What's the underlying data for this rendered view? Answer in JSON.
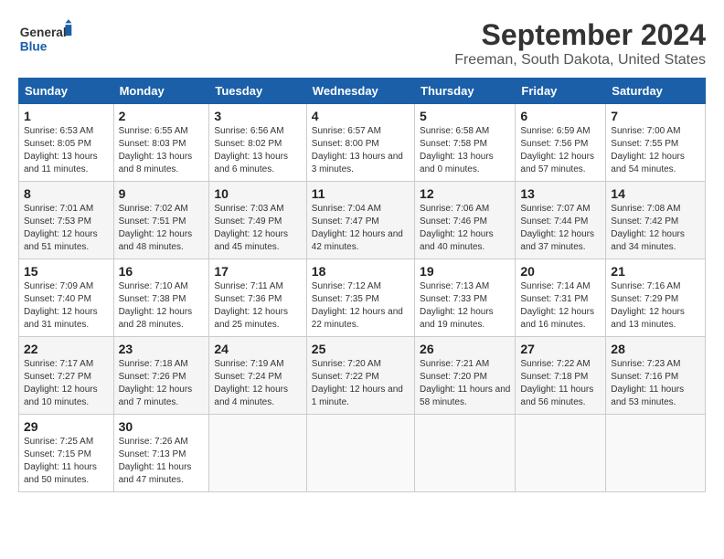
{
  "header": {
    "logo_general": "General",
    "logo_blue": "Blue",
    "title": "September 2024",
    "subtitle": "Freeman, South Dakota, United States"
  },
  "columns": [
    "Sunday",
    "Monday",
    "Tuesday",
    "Wednesday",
    "Thursday",
    "Friday",
    "Saturday"
  ],
  "weeks": [
    [
      {
        "day": "1",
        "sunrise": "6:53 AM",
        "sunset": "8:05 PM",
        "daylight": "13 hours and 11 minutes."
      },
      {
        "day": "2",
        "sunrise": "6:55 AM",
        "sunset": "8:03 PM",
        "daylight": "13 hours and 8 minutes."
      },
      {
        "day": "3",
        "sunrise": "6:56 AM",
        "sunset": "8:02 PM",
        "daylight": "13 hours and 6 minutes."
      },
      {
        "day": "4",
        "sunrise": "6:57 AM",
        "sunset": "8:00 PM",
        "daylight": "13 hours and 3 minutes."
      },
      {
        "day": "5",
        "sunrise": "6:58 AM",
        "sunset": "7:58 PM",
        "daylight": "13 hours and 0 minutes."
      },
      {
        "day": "6",
        "sunrise": "6:59 AM",
        "sunset": "7:56 PM",
        "daylight": "12 hours and 57 minutes."
      },
      {
        "day": "7",
        "sunrise": "7:00 AM",
        "sunset": "7:55 PM",
        "daylight": "12 hours and 54 minutes."
      }
    ],
    [
      {
        "day": "8",
        "sunrise": "7:01 AM",
        "sunset": "7:53 PM",
        "daylight": "12 hours and 51 minutes."
      },
      {
        "day": "9",
        "sunrise": "7:02 AM",
        "sunset": "7:51 PM",
        "daylight": "12 hours and 48 minutes."
      },
      {
        "day": "10",
        "sunrise": "7:03 AM",
        "sunset": "7:49 PM",
        "daylight": "12 hours and 45 minutes."
      },
      {
        "day": "11",
        "sunrise": "7:04 AM",
        "sunset": "7:47 PM",
        "daylight": "12 hours and 42 minutes."
      },
      {
        "day": "12",
        "sunrise": "7:06 AM",
        "sunset": "7:46 PM",
        "daylight": "12 hours and 40 minutes."
      },
      {
        "day": "13",
        "sunrise": "7:07 AM",
        "sunset": "7:44 PM",
        "daylight": "12 hours and 37 minutes."
      },
      {
        "day": "14",
        "sunrise": "7:08 AM",
        "sunset": "7:42 PM",
        "daylight": "12 hours and 34 minutes."
      }
    ],
    [
      {
        "day": "15",
        "sunrise": "7:09 AM",
        "sunset": "7:40 PM",
        "daylight": "12 hours and 31 minutes."
      },
      {
        "day": "16",
        "sunrise": "7:10 AM",
        "sunset": "7:38 PM",
        "daylight": "12 hours and 28 minutes."
      },
      {
        "day": "17",
        "sunrise": "7:11 AM",
        "sunset": "7:36 PM",
        "daylight": "12 hours and 25 minutes."
      },
      {
        "day": "18",
        "sunrise": "7:12 AM",
        "sunset": "7:35 PM",
        "daylight": "12 hours and 22 minutes."
      },
      {
        "day": "19",
        "sunrise": "7:13 AM",
        "sunset": "7:33 PM",
        "daylight": "12 hours and 19 minutes."
      },
      {
        "day": "20",
        "sunrise": "7:14 AM",
        "sunset": "7:31 PM",
        "daylight": "12 hours and 16 minutes."
      },
      {
        "day": "21",
        "sunrise": "7:16 AM",
        "sunset": "7:29 PM",
        "daylight": "12 hours and 13 minutes."
      }
    ],
    [
      {
        "day": "22",
        "sunrise": "7:17 AM",
        "sunset": "7:27 PM",
        "daylight": "12 hours and 10 minutes."
      },
      {
        "day": "23",
        "sunrise": "7:18 AM",
        "sunset": "7:26 PM",
        "daylight": "12 hours and 7 minutes."
      },
      {
        "day": "24",
        "sunrise": "7:19 AM",
        "sunset": "7:24 PM",
        "daylight": "12 hours and 4 minutes."
      },
      {
        "day": "25",
        "sunrise": "7:20 AM",
        "sunset": "7:22 PM",
        "daylight": "12 hours and 1 minute."
      },
      {
        "day": "26",
        "sunrise": "7:21 AM",
        "sunset": "7:20 PM",
        "daylight": "11 hours and 58 minutes."
      },
      {
        "day": "27",
        "sunrise": "7:22 AM",
        "sunset": "7:18 PM",
        "daylight": "11 hours and 56 minutes."
      },
      {
        "day": "28",
        "sunrise": "7:23 AM",
        "sunset": "7:16 PM",
        "daylight": "11 hours and 53 minutes."
      }
    ],
    [
      {
        "day": "29",
        "sunrise": "7:25 AM",
        "sunset": "7:15 PM",
        "daylight": "11 hours and 50 minutes."
      },
      {
        "day": "30",
        "sunrise": "7:26 AM",
        "sunset": "7:13 PM",
        "daylight": "11 hours and 47 minutes."
      },
      null,
      null,
      null,
      null,
      null
    ]
  ]
}
